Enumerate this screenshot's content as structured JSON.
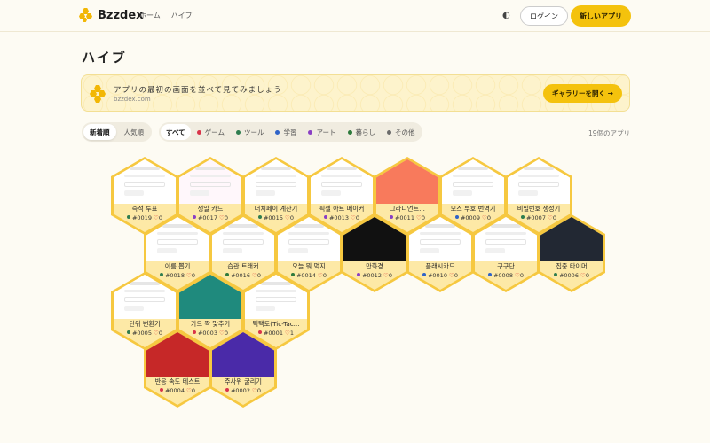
{
  "brand": {
    "name": "Bzzdex"
  },
  "nav": {
    "home": "ホーム",
    "hive": "ハイブ"
  },
  "header": {
    "theme_icon": "◐",
    "login": "ログイン",
    "new_app": "新しいアプリ"
  },
  "page": {
    "title": "ハイブ"
  },
  "banner": {
    "title": "アプリの最初の画面を並べて見てみましょう",
    "subtitle": "bzzdex.com",
    "button": "ギャラリーを開く →"
  },
  "sort": {
    "newest": "新着順",
    "popular": "人気順"
  },
  "filters": [
    {
      "label": "すべて",
      "color": ""
    },
    {
      "label": "ゲーム",
      "color": "#d9344a"
    },
    {
      "label": "ツール",
      "color": "#2f7d4f"
    },
    {
      "label": "学習",
      "color": "#2f63c8"
    },
    {
      "label": "アート",
      "color": "#8a3fc4"
    },
    {
      "label": "暮らし",
      "color": "#2e7a3c"
    },
    {
      "label": "その他",
      "color": "#6b6b6b"
    }
  ],
  "count": "19個のアプリ",
  "apps": [
    {
      "title": "즉석 투표",
      "id": "#0019",
      "likes": "0",
      "cat": "#2f7d4f",
      "thumb": "#ffffff"
    },
    {
      "title": "생일 카드",
      "id": "#0017",
      "likes": "0",
      "cat": "#8a3fc4",
      "thumb": "#fff7fb"
    },
    {
      "title": "더치페이 계산기",
      "id": "#0015",
      "likes": "0",
      "cat": "#2f7d4f",
      "thumb": "#ffffff"
    },
    {
      "title": "픽셀 아트 메이커",
      "id": "#0013",
      "likes": "0",
      "cat": "#8a3fc4",
      "thumb": "#ffffff"
    },
    {
      "title": "그라디언트...",
      "id": "#0011",
      "likes": "0",
      "cat": "#8a3fc4",
      "thumb": "#f87a5c"
    },
    {
      "title": "모스 부호 번역기",
      "id": "#0009",
      "likes": "0",
      "cat": "#2f63c8",
      "thumb": "#ffffff"
    },
    {
      "title": "비밀번호 생성기",
      "id": "#0007",
      "likes": "0",
      "cat": "#2f7d4f",
      "thumb": "#ffffff"
    },
    {
      "title": "이름 뽑기",
      "id": "#0018",
      "likes": "0",
      "cat": "#2f7d4f",
      "thumb": "#ffffff"
    },
    {
      "title": "습관 트래커",
      "id": "#0016",
      "likes": "0",
      "cat": "#2e7a3c",
      "thumb": "#ffffff"
    },
    {
      "title": "오늘 뭐 먹지",
      "id": "#0014",
      "likes": "0",
      "cat": "#2e7a3c",
      "thumb": "#ffffff"
    },
    {
      "title": "만화경",
      "id": "#0012",
      "likes": "0",
      "cat": "#8a3fc4",
      "thumb": "#111111"
    },
    {
      "title": "플래시카드",
      "id": "#0010",
      "likes": "0",
      "cat": "#2f63c8",
      "thumb": "#ffffff"
    },
    {
      "title": "구구단",
      "id": "#0008",
      "likes": "0",
      "cat": "#2f63c8",
      "thumb": "#ffffff"
    },
    {
      "title": "집중 타이머",
      "id": "#0006",
      "likes": "0",
      "cat": "#2f7d4f",
      "thumb": "#222833"
    },
    {
      "title": "단위 변환기",
      "id": "#0005",
      "likes": "0",
      "cat": "#2f7d4f",
      "thumb": "#ffffff"
    },
    {
      "title": "카드 짝 맞추기",
      "id": "#0003",
      "likes": "0",
      "cat": "#d9344a",
      "thumb": "#1f8a7d"
    },
    {
      "title": "틱택토(Tic-Tac...",
      "id": "#0001",
      "likes": "1",
      "cat": "#d9344a",
      "thumb": "#ffffff"
    },
    {
      "title": "반응 속도 테스트",
      "id": "#0004",
      "likes": "0",
      "cat": "#d9344a",
      "thumb": "#c62828"
    },
    {
      "title": "주사위 굴리기",
      "id": "#0002",
      "likes": "0",
      "cat": "#d9344a",
      "thumb": "#4a2aa8"
    }
  ]
}
